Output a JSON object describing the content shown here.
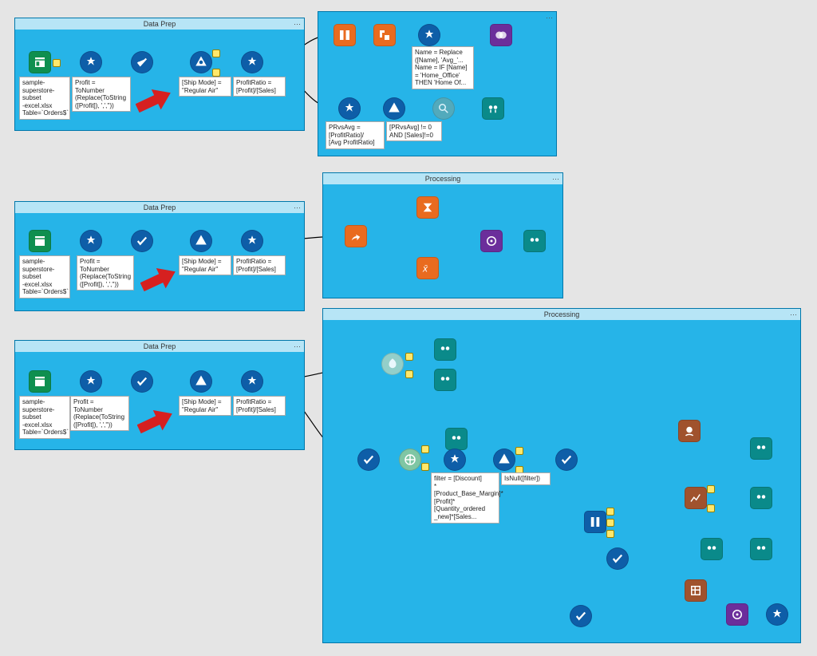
{
  "containers": {
    "dp1": {
      "title": "Data Prep"
    },
    "dp2": {
      "title": "Data Prep"
    },
    "dp3": {
      "title": "Data Prep"
    },
    "proc1": {
      "title": "Processing"
    },
    "proc2": {
      "title": "Processing"
    }
  },
  "labels": {
    "input": "sample-\nsuperstore-subset\n-excel.xlsx\nTable=`Orders$`",
    "profit": "Profit =\nToNumber\n(Replace(ToString\n([Profit]), ',',''))",
    "shipmode": "[Ship Mode] =\n\"Regular Air\"",
    "profitratio": "ProfitRatio =\n[Profit]/[Sales]",
    "prvsavg": "PRvsAvg =\n[ProfitRatio]/\n[Avg ProfitRatio]",
    "prvsavg_ne": "[PRvsAvg] != 0\nAND [Sales]!=0",
    "nameRepl": "Name = Replace\n([Name], 'Avg_'...\nName = IF [Name]\n= 'Home_Office'\nTHEN 'Home Of...",
    "filter": "filter = [Discount]\n*\n[Product_Base_Margin]*[Profit]*\n[Quantity_ordered\n_new]*[Sales...",
    "isnull": "IsNull([filter])"
  },
  "colors": {
    "green": "#0f8f4f",
    "blue": "#0e5ea8",
    "orange": "#e96b1f",
    "purple": "#6b2e9b",
    "teal": "#0a8a8a",
    "brown": "#a0522d",
    "mint": "#7fc6a4",
    "white": "#fff"
  }
}
